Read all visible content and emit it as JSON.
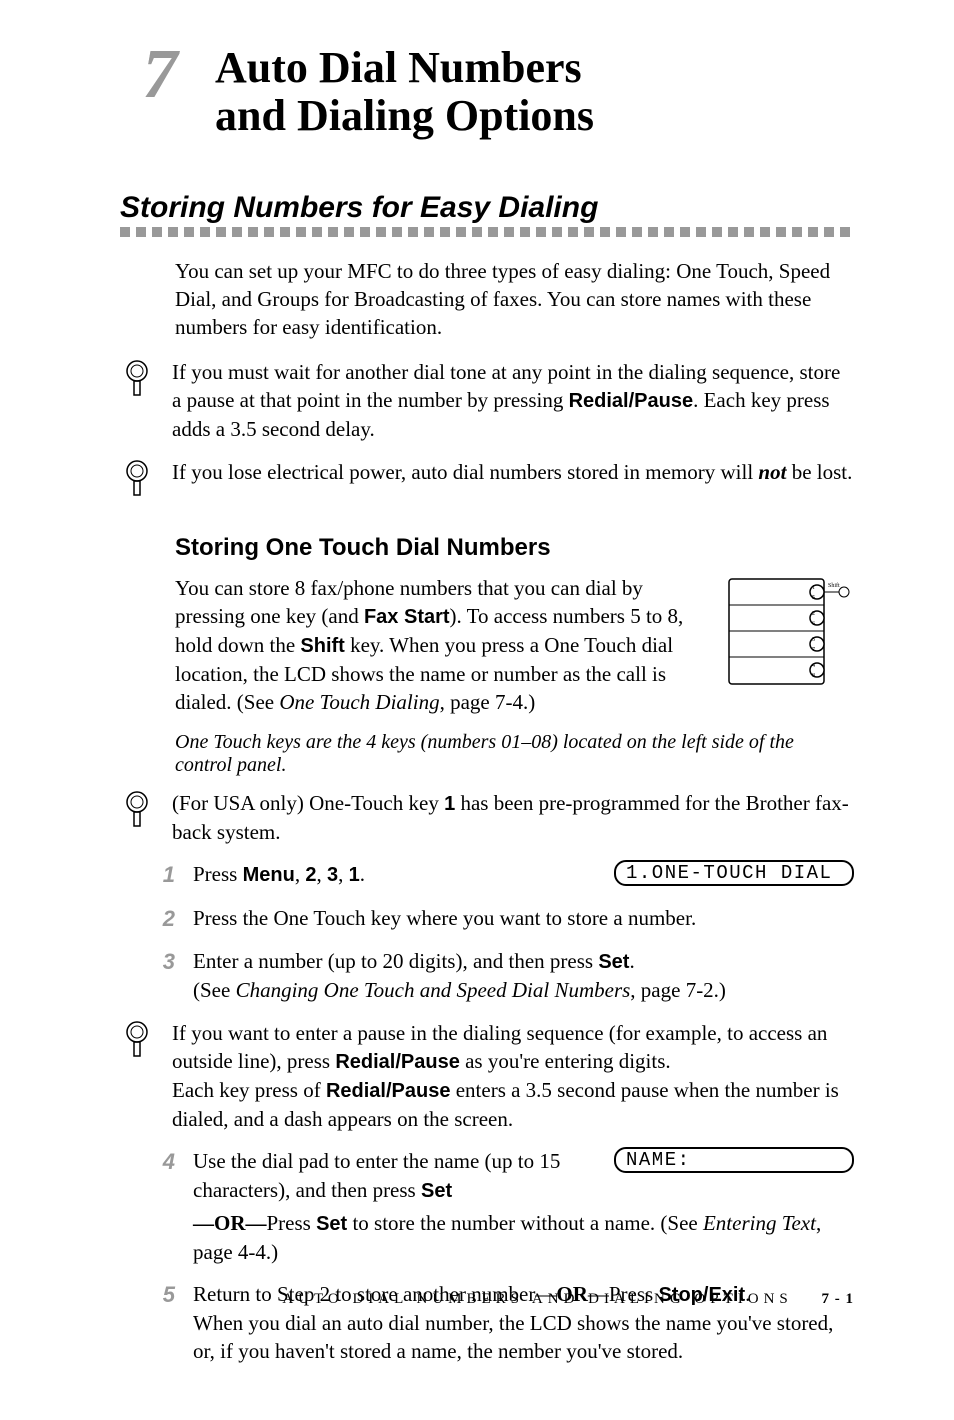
{
  "chapter": {
    "number": "7",
    "title_line1": "Auto Dial Numbers",
    "title_line2": "and Dialing Options"
  },
  "section": {
    "heading": "Storing Numbers for Easy Dialing"
  },
  "p1": "You can set up your MFC to do three types of easy dialing: One Touch, Speed Dial, and Groups for Broadcasting of faxes. You can store names with these numbers for easy identification.",
  "note1": {
    "pre": "If you must wait for another dial tone at any point in the dialing sequence, store a pause at that point in the number by pressing ",
    "key": "Redial/Pause",
    "post": ". Each key press adds a 3.5 second delay."
  },
  "note2": {
    "pre": "If you lose electrical power, auto dial numbers stored in memory will ",
    "em": "not",
    "post": " be lost."
  },
  "sub": "Storing One Touch Dial Numbers",
  "p2": {
    "a": "You can store 8 fax/phone numbers that you can dial by pressing one key (and  ",
    "k1": "Fax Start",
    "b": "). To access numbers 5 to 8, hold down the ",
    "k2": "Shift",
    "c": " key. When you press a One Touch dial location, the LCD shows the name or number as the call is dialed. (See ",
    "ref": "One Touch Dialing",
    "d": ", page 7-4.)"
  },
  "italic": "One Touch keys are the 4 keys (numbers 01–08) located on the left side of the control panel.",
  "note3": {
    "a": "(For USA only) One-Touch key ",
    "k": "1",
    "b": " has been pre-programmed for the Brother fax-back system."
  },
  "steps": {
    "s1": {
      "n": "1",
      "a": "Press ",
      "k1": "Menu",
      "sep1": ", ",
      "k2": "2",
      "sep2": ", ",
      "k3": "3",
      "sep3": ", ",
      "k4": "1",
      "end": "."
    },
    "s2": {
      "n": "2",
      "t": "Press the One Touch key where you want to store a number."
    },
    "s3": {
      "n": "3",
      "a": "Enter a number (up to 20 digits), and then press ",
      "k": "Set",
      "b": ".",
      "c": "(See ",
      "ref": "Changing One Touch and Speed Dial Numbers",
      "d": ", page 7-2.)"
    },
    "s4": {
      "n": "4",
      "a": "Use the dial pad to enter the name (up to 15 characters), and then press ",
      "k1": "Set",
      "or1": "—OR—",
      "b": "Press ",
      "k2": "Set",
      "c": " to store the number without a name. (See ",
      "ref": "Entering Text",
      "d": ", page 4-4.)"
    },
    "s5": {
      "n": "5",
      "a": "Return to Step 2 to store another number—",
      "or": "OR",
      "b": "—Press ",
      "k": "Stop/Exit",
      "c": ".",
      "d": "When you dial an auto dial number, the LCD shows the name you've stored, or, if you haven't stored a name, the nember you've stored."
    }
  },
  "note4": {
    "a": "If you want to enter a pause in the dialing sequence (for example, to access an outside line), press ",
    "k1": "Redial/Pause",
    "b": " as you're entering digits.",
    "c": "Each key press of ",
    "k2": "Redial/Pause",
    "d": " enters a 3.5 second pause when the number is dialed, and a dash appears on the screen."
  },
  "lcd1": "1.ONE-TOUCH DIAL",
  "lcd2": "NAME:",
  "footer": {
    "chapter_ref": "AUTO DIAL NUMBERS AND DIALING OPTIONS",
    "page": "7 - 1"
  }
}
